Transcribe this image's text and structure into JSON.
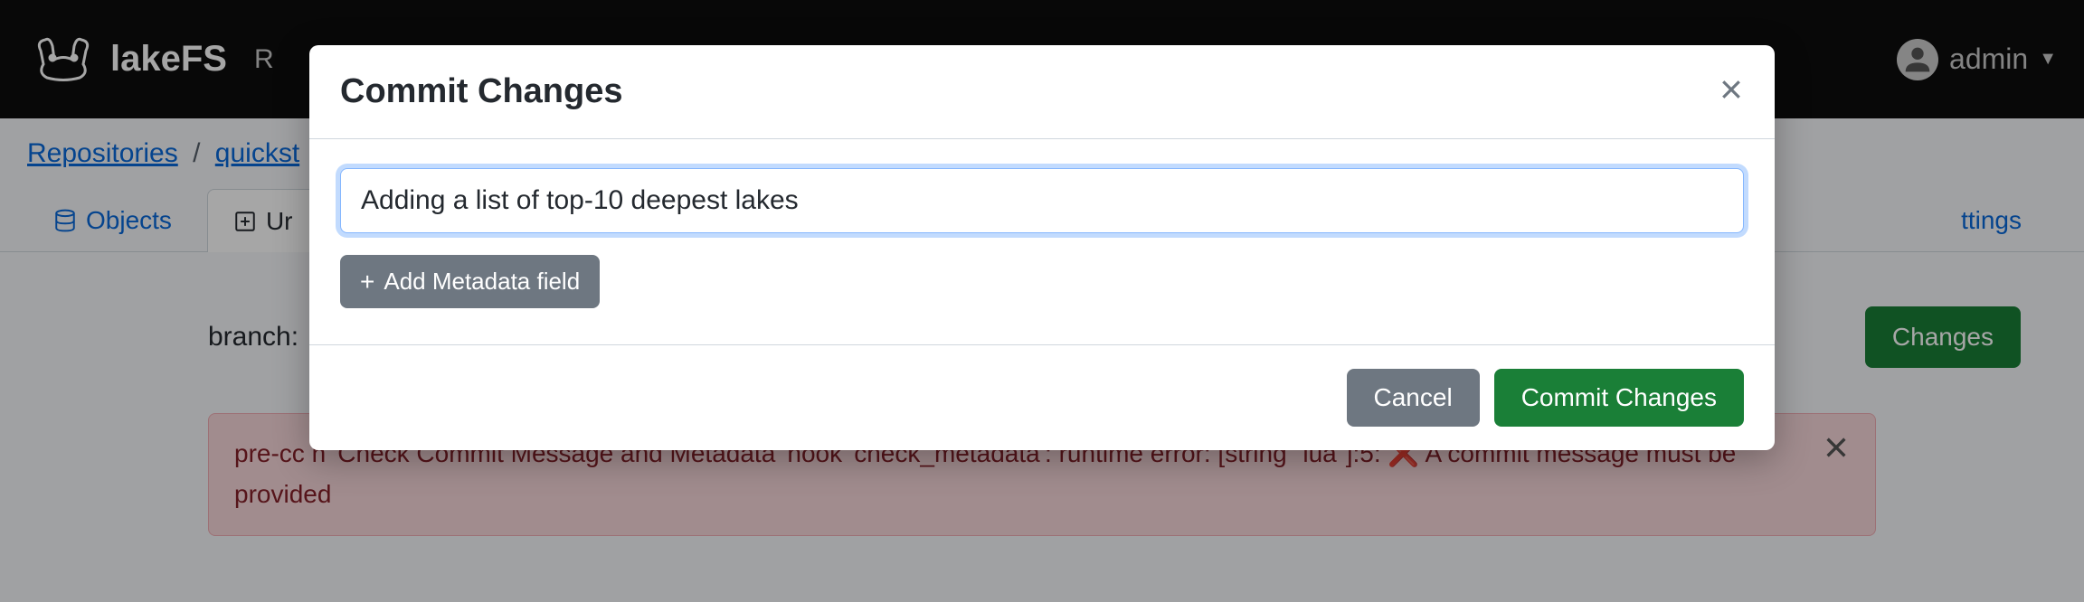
{
  "navbar": {
    "logo_text": "lakeFS",
    "nav_r": "R",
    "user": "admin"
  },
  "breadcrumb": {
    "repositories": "Repositories",
    "repo": "quickst"
  },
  "tabs": {
    "objects": "Objects",
    "uncommitted": "Ur",
    "settings": "ttings"
  },
  "branch": {
    "label": "branch:",
    "commit_button": "Changes"
  },
  "alert": {
    "text": "pre-cc                                                                                                                                                                                                                                                                   n 'Check Commit Message and Metadata' hook 'check_metadata': runtime error: [string \"lua\"]:5: ❌ A commit message must be provided"
  },
  "modal": {
    "title": "Commit Changes",
    "input_value": "Adding a list of top-10 deepest lakes",
    "add_metadata": "Add Metadata field",
    "cancel": "Cancel",
    "commit": "Commit Changes"
  }
}
